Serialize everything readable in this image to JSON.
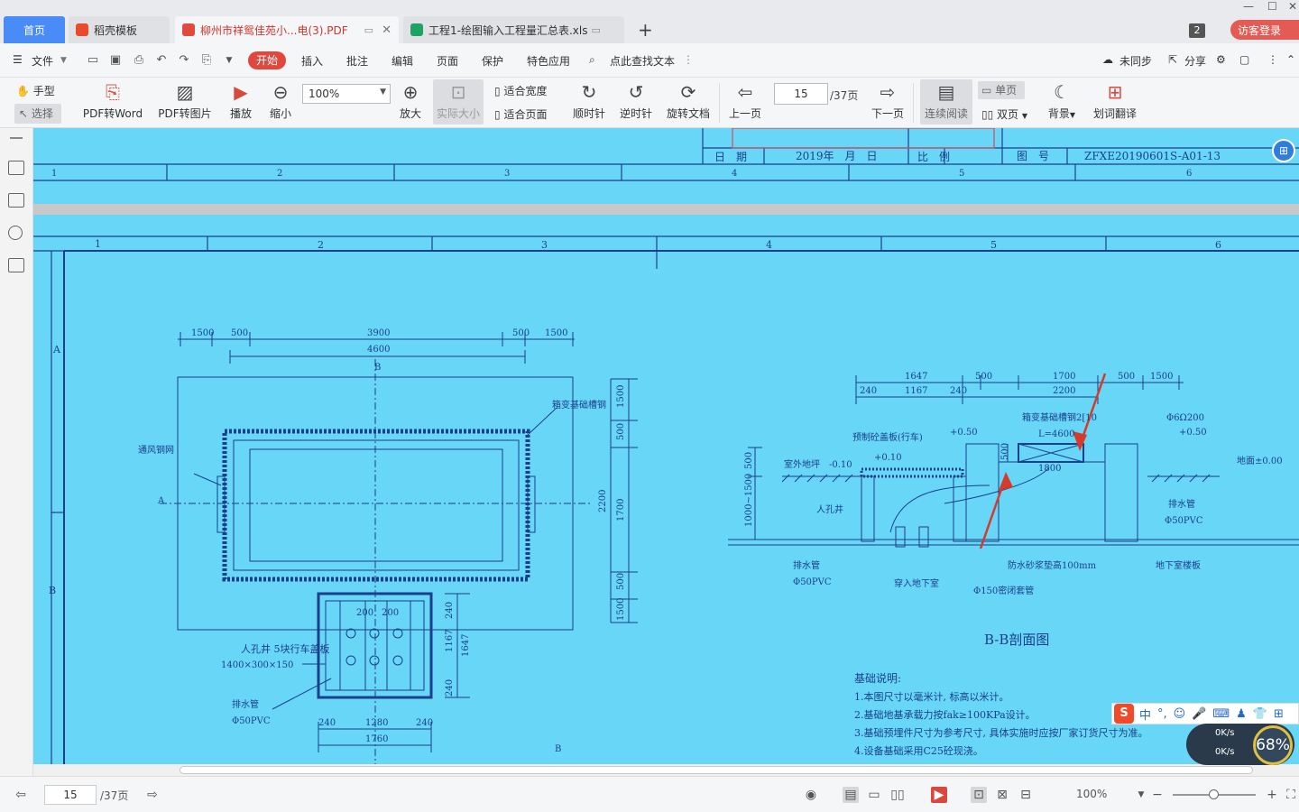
{
  "tabs": {
    "home": "首页",
    "templates": "稻壳模板",
    "pdf": "柳州市祥鸳佳苑小...电(3).PDF",
    "xls": "工程1-绘图输入工程量汇总表.xls",
    "new_tab": "+"
  },
  "window": {
    "count_badge": "2",
    "login": "访客登录"
  },
  "menu": {
    "file": "文件",
    "start": "开始",
    "insert": "插入",
    "annotate": "批注",
    "edit": "编辑",
    "page": "页面",
    "protect": "保护",
    "features": "特色应用",
    "search": "点此查找文本",
    "sync": "未同步",
    "share": "分享"
  },
  "ribbon": {
    "hand": "手型",
    "select": "选择",
    "pdf_to_word": "PDF转Word",
    "pdf_to_image": "PDF转图片",
    "play": "播放",
    "zoom_out": "缩小",
    "zoom_value": "100%",
    "zoom_in": "放大",
    "actual_size": "实际大小",
    "fit_width": "适合宽度",
    "fit_page": "适合页面",
    "rotate_cw": "顺时针",
    "rotate_ccw": "逆时针",
    "rotate_doc": "旋转文档",
    "prev_page": "上一页",
    "current_page": "15",
    "total_pages": "/37页",
    "next_page": "下一页",
    "continuous": "连续阅读",
    "single": "单页",
    "double": "双页",
    "background": "背景",
    "translate": "划词翻译"
  },
  "drawing_top": {
    "date_label": "日　期",
    "date_value": "2019年　月　日",
    "scale_label": "比　例",
    "drawing_no_label": "图　号",
    "drawing_no": "ZFXE20190601S-A01-13",
    "grid": [
      "1",
      "2",
      "3",
      "4",
      "5",
      "6"
    ]
  },
  "drawing": {
    "grid": [
      "1",
      "2",
      "3",
      "4",
      "5",
      "6"
    ],
    "rows": [
      "A",
      "B"
    ],
    "plan_dims_top": [
      "1500",
      "500",
      "3900",
      "500",
      "1500"
    ],
    "plan_total": "4600",
    "section_mark_b": "B",
    "section_mark_a": "A",
    "label_vent": "通风钢网",
    "label_steel": "箱变基础槽钢",
    "right_dims": [
      "1500",
      "500",
      "2200",
      "1700",
      "500",
      "1500"
    ],
    "manhole_label": "人孔井 5块行车盖板",
    "manhole_size": "1400×300×150",
    "drain_label": "排水管",
    "drain_spec": "Φ50PVC",
    "bottom_dims": [
      "240",
      "1280",
      "240"
    ],
    "bottom_total": "1760",
    "manhole_inner": [
      "200",
      "200"
    ],
    "manhole_right": [
      "240",
      "1167",
      "240",
      "1647"
    ],
    "sec_dims_top": [
      "1647",
      "500",
      "1700",
      "500",
      "1500"
    ],
    "sec_dims_sub": [
      "240",
      "1167",
      "240",
      "2200"
    ],
    "sec_precast": "预制砼盖板(行车)",
    "sec_p010": "+0.10",
    "sec_p050": "+0.50",
    "sec_outdoor": "室外地坪　-0.10",
    "sec_steel": "箱变基础槽钢2[10",
    "sec_l": "L=4600",
    "sec_1800": "1800",
    "sec_pipe": "Φ6Ω200",
    "sec_p050b": "+0.50",
    "sec_ground": "地面±0.00",
    "sec_manhole": "人孔井",
    "sec_1000": "1000~1500",
    "sec_500": "500",
    "sec_drain": "排水管",
    "sec_drain_spec": "Φ50PVC",
    "sec_drain2": "排水管",
    "sec_drain2_spec": "Φ50PVC",
    "sec_to_basement": "穿入地下室",
    "sec_waterproof": "防水砂浆垫高100mm",
    "sec_basement_floor": "地下室楼板",
    "sec_casing": "Φ150密闭套管",
    "sec_title": "B-B剖面图",
    "notes_title": "基础说明:",
    "notes": [
      "1.本图尺寸以毫米计, 标高以米计。",
      "2.基础地基承载力按fak≥100KPa设计。",
      "3.基础预埋件尺寸为参考尺寸, 具体实施时应按厂家订货尺寸为准。",
      "4.设备基础采用C25砼现浇。"
    ]
  },
  "ime": {
    "lang": "中",
    "speed_up": "0K/s",
    "speed_down": "0K/s",
    "percent": "68%"
  },
  "status": {
    "page": "15",
    "total": "/37页",
    "zoom": "100%"
  }
}
